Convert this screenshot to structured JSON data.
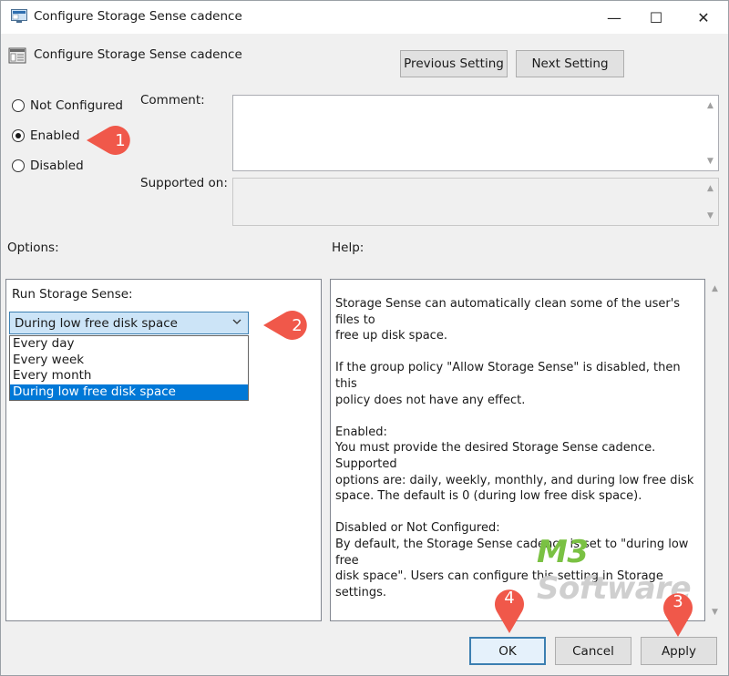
{
  "window": {
    "title": "Configure Storage Sense cadence",
    "controls": {
      "minimize": "—",
      "maximize": "☐",
      "close": "✕"
    }
  },
  "header": {
    "title": "Configure Storage Sense cadence",
    "previous_label": "Previous Setting",
    "next_label": "Next Setting"
  },
  "state": {
    "options": [
      {
        "label": "Not Configured",
        "checked": false
      },
      {
        "label": "Enabled",
        "checked": true
      },
      {
        "label": "Disabled",
        "checked": false
      }
    ]
  },
  "fields": {
    "comment_label": "Comment:",
    "supported_label": "Supported on:"
  },
  "sections": {
    "options_label": "Options:",
    "help_label": "Help:"
  },
  "options_panel": {
    "run_label": "Run Storage Sense:",
    "selected": "During low free disk space",
    "dropdown_items": [
      "Every day",
      "Every week",
      "Every month",
      "During low free disk space"
    ],
    "highlighted_index": 3
  },
  "help": {
    "paragraphs": [
      "Storage Sense can automatically clean some of the user's files to\nfree up disk space.",
      "If the group policy \"Allow Storage Sense\" is disabled, then this\npolicy does not have any effect.",
      "Enabled:\nYou must provide the desired Storage Sense cadence. Supported\noptions are: daily, weekly, monthly, and during low free disk\nspace. The default is 0 (during low free disk space).",
      "Disabled or Not Configured:\nBy default, the Storage Sense cadence is set to \"during low free\ndisk space\". Users can configure this setting in Storage settings."
    ]
  },
  "footer": {
    "ok_label": "OK",
    "cancel_label": "Cancel",
    "apply_label": "Apply"
  },
  "watermark": {
    "part1": "M3",
    "part2": " Software",
    "color1": "#7ac143",
    "color2": "#cfcfcf"
  },
  "badges": {
    "color": "#f0584a",
    "b1": "1",
    "b2": "2",
    "b3": "3",
    "b4": "4"
  }
}
